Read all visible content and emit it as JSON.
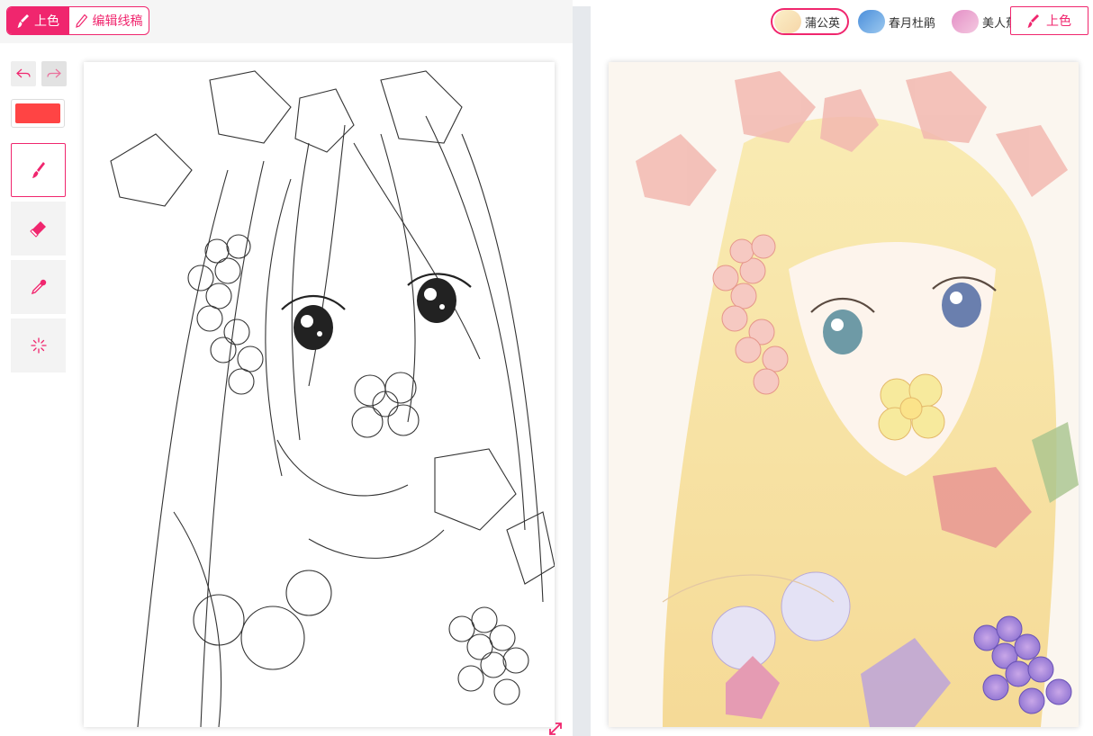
{
  "left_header": {
    "mode_colorize_label": "上色",
    "mode_edit_label": "编辑线稿"
  },
  "toolbar": {
    "undo_icon": "undo-icon",
    "redo_icon": "redo-icon",
    "current_color": "#ff4444",
    "tools": [
      {
        "name": "brush",
        "icon": "brush-icon",
        "selected": true
      },
      {
        "name": "eraser",
        "icon": "eraser-icon",
        "selected": false
      },
      {
        "name": "eyedropper",
        "icon": "eyedropper-icon",
        "selected": false
      },
      {
        "name": "magic",
        "icon": "sparkle-icon",
        "selected": false
      }
    ]
  },
  "right_header": {
    "styles": [
      {
        "label": "蒲公英",
        "selected": true,
        "thumb_color": "#f4e7b8"
      },
      {
        "label": "春月杜鹃",
        "selected": false,
        "thumb_color": "#6aa4e0"
      },
      {
        "label": "美人蕉属",
        "selected": false,
        "thumb_color": "#e7a7cf"
      }
    ],
    "colorize_button_label": "上色"
  },
  "colors": {
    "accent": "#f0266e",
    "divider": "#e6e9ed"
  }
}
